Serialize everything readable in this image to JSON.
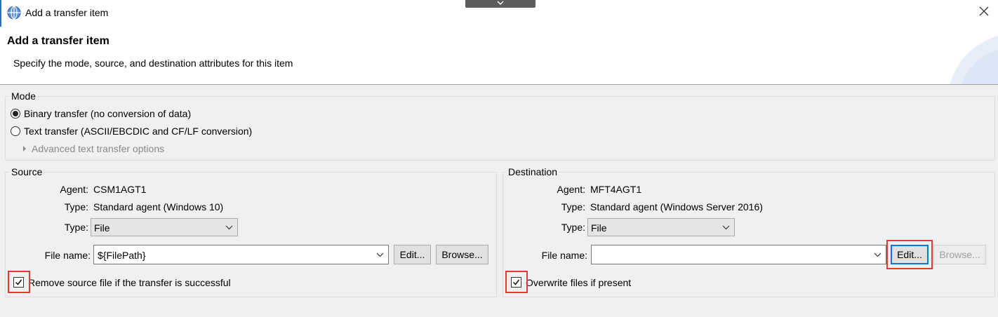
{
  "window": {
    "title": "Add a transfer item",
    "close_icon": "close-icon"
  },
  "header": {
    "title": "Add a transfer item",
    "description": "Specify the mode, source, and destination attributes for this item"
  },
  "mode": {
    "label": "Mode",
    "options": [
      {
        "label": "Binary transfer (no conversion of data)",
        "selected": true
      },
      {
        "label": "Text transfer (ASCII/EBCDIC and CF/LF conversion)",
        "selected": false
      }
    ],
    "advanced_label": "Advanced text transfer options"
  },
  "source": {
    "label": "Source",
    "agent_label": "Agent:",
    "agent_value": "CSM1AGT1",
    "agent_type_label": "Type:",
    "agent_type_value": "Standard agent (Windows 10)",
    "type_label": "Type:",
    "type_value": "File",
    "file_name_label": "File name:",
    "file_name_value": "${FilePath}",
    "edit_label": "Edit...",
    "browse_label": "Browse...",
    "checkbox_label": "Remove source file if the transfer is successful",
    "checkbox_checked": true
  },
  "destination": {
    "label": "Destination",
    "agent_label": "Agent:",
    "agent_value": "MFT4AGT1",
    "agent_type_label": "Type:",
    "agent_type_value": "Standard agent (Windows Server 2016)",
    "type_label": "Type:",
    "type_value": "File",
    "file_name_label": "File name:",
    "file_name_value": "",
    "edit_label": "Edit...",
    "browse_label": "Browse...",
    "checkbox_label": "Overwrite files if present",
    "checkbox_checked": true
  },
  "colors": {
    "highlight": "#e53935",
    "focus": "#0078d7",
    "accent": "#2b6db8"
  }
}
